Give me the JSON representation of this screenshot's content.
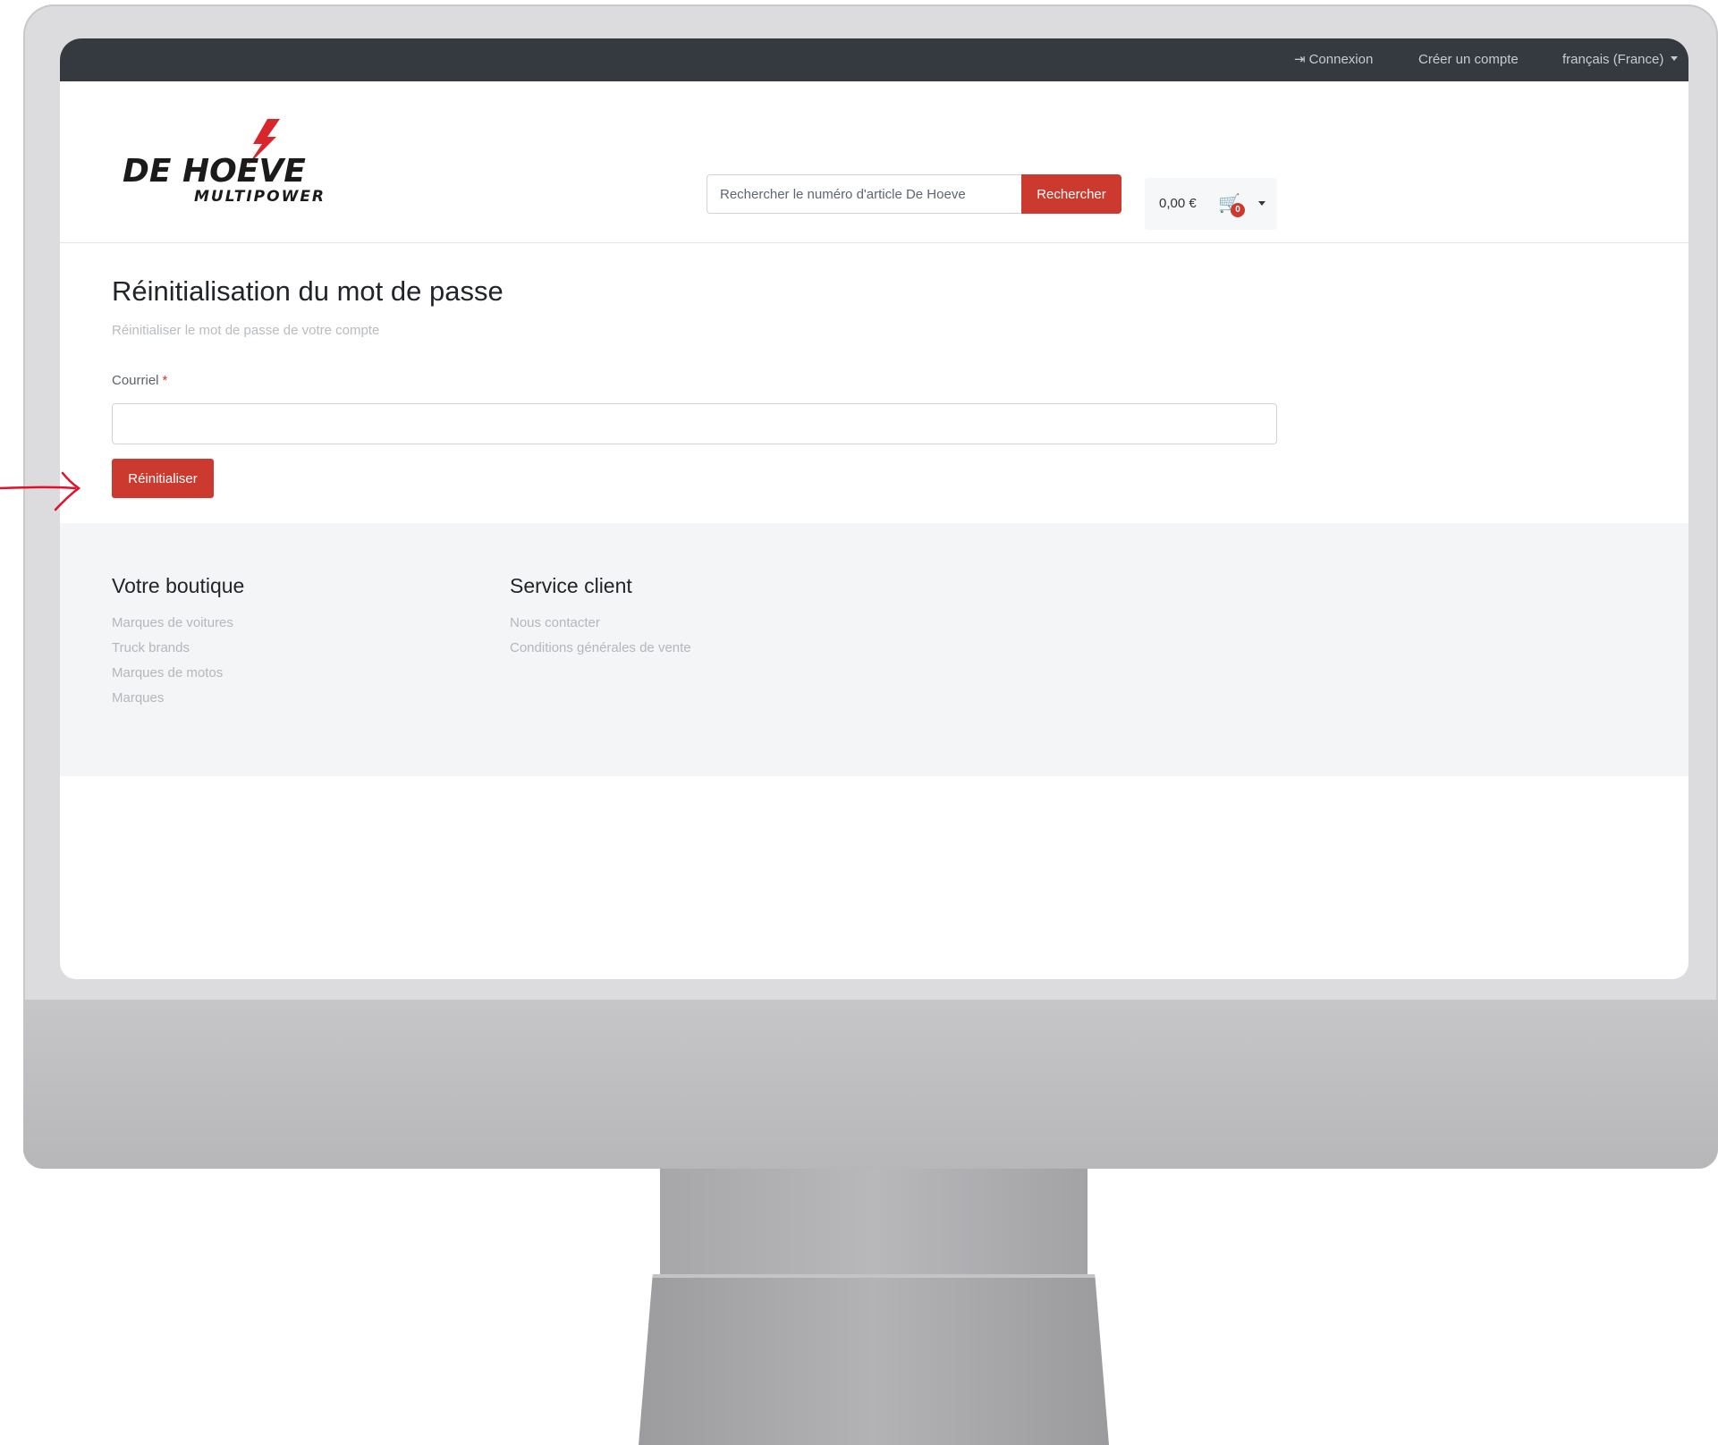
{
  "topbar": {
    "login_label": "Connexion",
    "register_label": "Créer un compte",
    "language_label": "français (France)"
  },
  "header": {
    "logo_text_top": "DE HOEVE",
    "logo_text_bottom": "MULTIPOWER",
    "search_placeholder": "Rechercher le numéro d'article De Hoeve",
    "search_button_label": "Rechercher",
    "cart_total": "0,00 €",
    "cart_count": "0"
  },
  "main": {
    "title": "Réinitialisation du mot de passe",
    "subtitle": "Réinitialiser le mot de passe de votre compte",
    "email_label": "Courriel",
    "required_mark": "*",
    "email_value": "",
    "reset_button_label": "Réinitialiser"
  },
  "footer": {
    "col1_heading": "Votre boutique",
    "col1_links": [
      "Marques de voitures",
      "Truck brands",
      "Marques de motos",
      "Marques"
    ],
    "col2_heading": "Service client",
    "col2_links": [
      "Nous contacter",
      "Conditions générales de vente"
    ]
  },
  "colors": {
    "accent": "#cc3a2f",
    "topbar": "#343a40",
    "footer_bg": "#f4f5f7",
    "annotation": "#e2102b"
  },
  "icons": {
    "login": "sign-in-icon",
    "cart": "shopping-cart-icon",
    "language": "caret-down-icon",
    "annotation": "hand-drawn-arrow"
  }
}
